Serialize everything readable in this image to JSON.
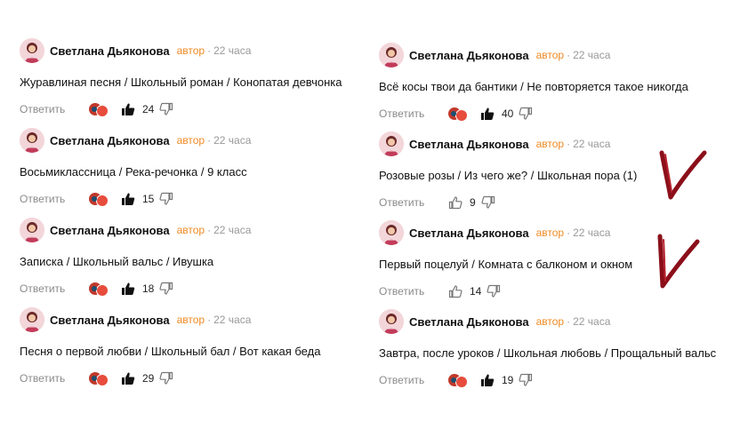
{
  "comments": [
    {
      "author": "Светлана Дьяконова",
      "badge": "автор",
      "sep": "·",
      "time": "22 часа",
      "text": "Журавлиная песня / Школьный роман / Конопатая девчонка",
      "reply": "Ответить",
      "likes": "24",
      "liked": true
    },
    {
      "author": "Светлана Дьяконова",
      "badge": "автор",
      "sep": "·",
      "time": "22 часа",
      "text": "Восьмиклассница / Река-речонка / 9 класс",
      "reply": "Ответить",
      "likes": "15",
      "liked": true
    },
    {
      "author": "Светлана Дьяконова",
      "badge": "автор",
      "sep": "·",
      "time": "22 часа",
      "text": "Записка / Школьный вальс / Ивушка",
      "reply": "Ответить",
      "likes": "18",
      "liked": true
    },
    {
      "author": "Светлана Дьяконова",
      "badge": "автор",
      "sep": "·",
      "time": "22 часа",
      "text": "Песня о первой любви / Школьный бал / Вот какая беда",
      "reply": "Ответить",
      "likes": "29",
      "liked": true
    },
    {
      "author": "Светлана Дьяконова",
      "badge": "автор",
      "sep": "·",
      "time": "22 часа",
      "text": "Всё косы твои да бантики / Не повторяется такое никогда",
      "reply": "Ответить",
      "likes": "40",
      "liked": true
    },
    {
      "author": "Светлана Дьяконова",
      "badge": "автор",
      "sep": "·",
      "time": "22 часа",
      "text": "Розовые розы / Из чего же? / Школьная пора (1)",
      "reply": "Ответить",
      "likes": "9",
      "liked": false
    },
    {
      "author": "Светлана Дьяконова",
      "badge": "автор",
      "sep": "·",
      "time": "22 часа",
      "text": "Первый поцелуй / Комната с балконом и окном",
      "reply": "Ответить",
      "likes": "14",
      "liked": false
    },
    {
      "author": "Светлана Дьяконова",
      "badge": "автор",
      "sep": "·",
      "time": "22 часа",
      "text": "Завтра, после уроков / Школьная любовь / Прощальный вальс",
      "reply": "Ответить",
      "likes": "19",
      "liked": true
    }
  ],
  "colors": {
    "badge": "#f08a24",
    "check": "#8b0f1a"
  },
  "icons": [
    "avatar",
    "reactions-icon",
    "thumbs-up-icon",
    "thumbs-down-icon",
    "checkmark"
  ]
}
